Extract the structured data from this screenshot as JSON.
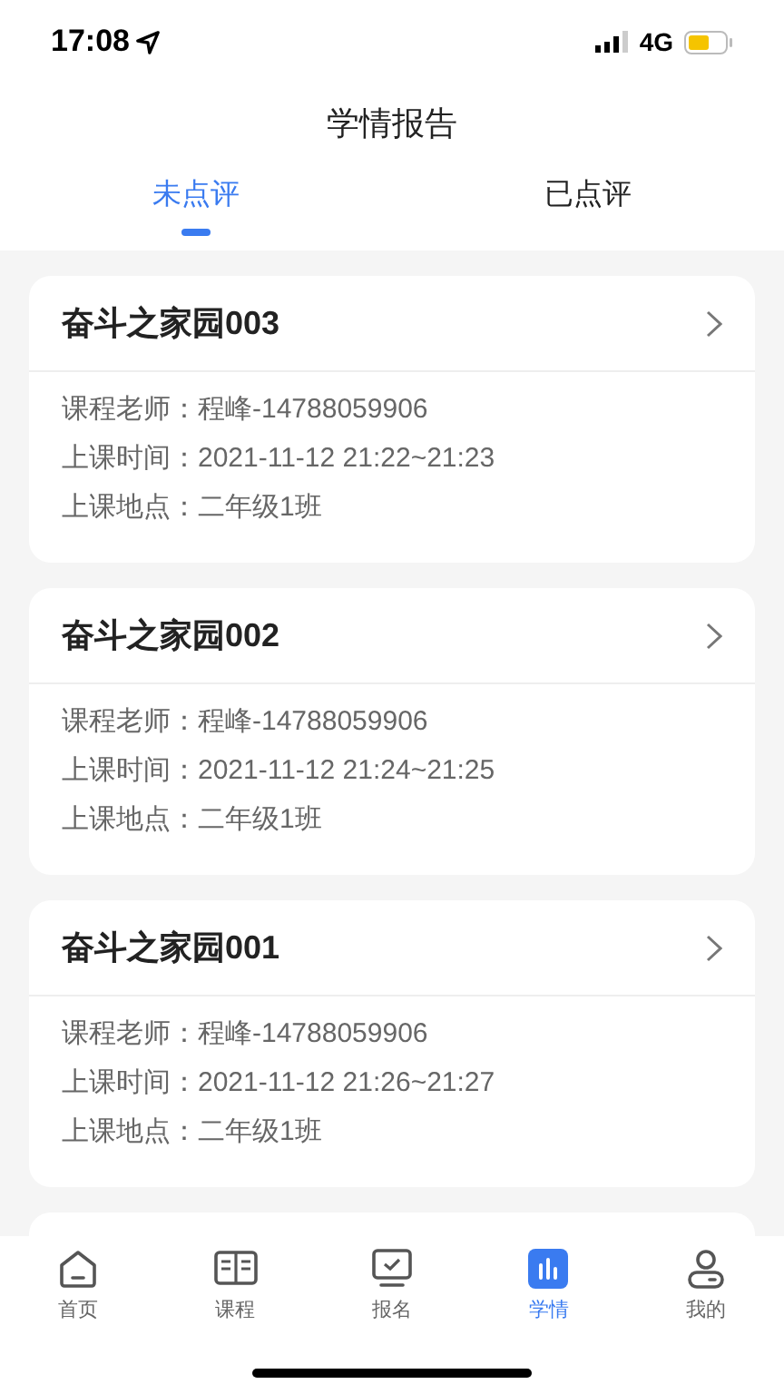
{
  "status_bar": {
    "time": "17:08",
    "network": "4G"
  },
  "title": "学情报告",
  "tabs": [
    {
      "label": "未点评",
      "selected": true
    },
    {
      "label": "已点评",
      "selected": false
    }
  ],
  "cards": [
    {
      "title": "奋斗之家园003",
      "fields": [
        {
          "label": "课程老师：",
          "value": "程峰-14788059906"
        },
        {
          "label": "上课时间：",
          "value": "2021-11-12 21:22~21:23"
        },
        {
          "label": "上课地点：",
          "value": "二年级1班"
        }
      ]
    },
    {
      "title": "奋斗之家园002",
      "fields": [
        {
          "label": "课程老师：",
          "value": "程峰-14788059906"
        },
        {
          "label": "上课时间：",
          "value": "2021-11-12 21:24~21:25"
        },
        {
          "label": "上课地点：",
          "value": "二年级1班"
        }
      ]
    },
    {
      "title": "奋斗之家园001",
      "fields": [
        {
          "label": "课程老师：",
          "value": "程峰-14788059906"
        },
        {
          "label": "上课时间：",
          "value": "2021-11-12 21:26~21:27"
        },
        {
          "label": "上课地点：",
          "value": "二年级1班"
        }
      ]
    }
  ],
  "nav": [
    {
      "kind": "home",
      "label": "首页",
      "selected": false
    },
    {
      "kind": "book",
      "label": "课程",
      "selected": false
    },
    {
      "kind": "monitor",
      "label": "报名",
      "selected": false
    },
    {
      "kind": "chart",
      "label": "学情",
      "selected": true
    },
    {
      "kind": "user",
      "label": "我的",
      "selected": false
    }
  ]
}
